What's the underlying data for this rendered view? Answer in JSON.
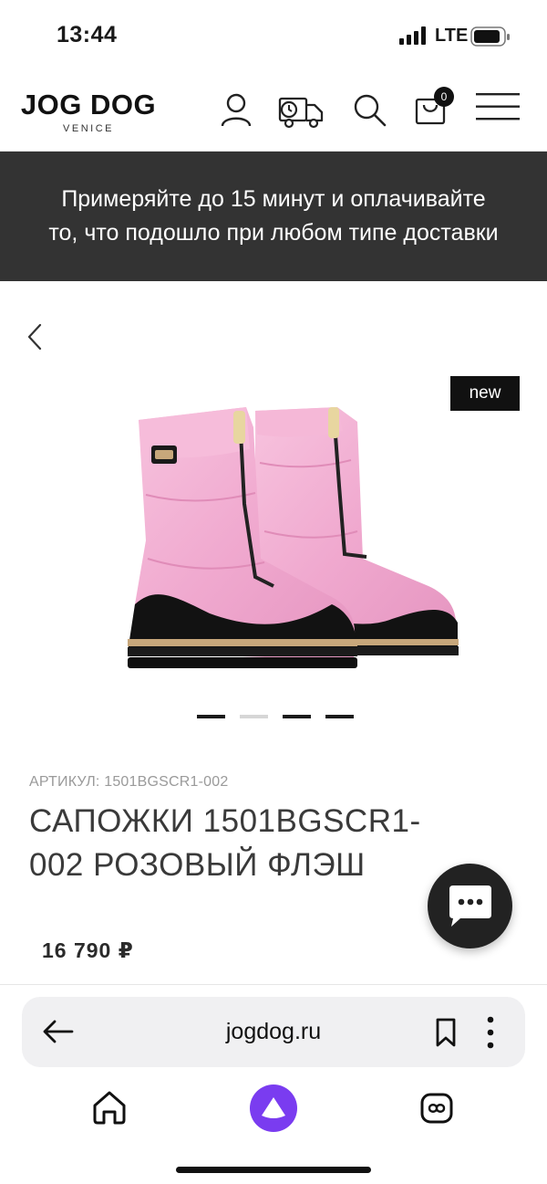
{
  "status_bar": {
    "time": "13:44",
    "network": "LTE"
  },
  "header": {
    "logo_main": "JOG DOG",
    "logo_sub": "VENICE",
    "cart_count": "0",
    "icons": [
      "user-icon",
      "delivery-truck-icon",
      "search-icon",
      "cart-icon",
      "menu-icon"
    ]
  },
  "promo": {
    "text": "Примеряйте до 15 минут и оплачивайте то, что подошло при любом типе доставки"
  },
  "product": {
    "badge": "new",
    "sku_label": "АРТИКУЛ: 1501BGSCR1-002",
    "title": "САПОЖКИ 1501BGSCR1-002 РОЗОВЫЙ ФЛЭШ",
    "price": "16 790 ₽",
    "gallery_count": 4,
    "gallery_active_index": 0,
    "colors": {
      "upper": "#f3b0d2",
      "sole": "#121212",
      "stripe": "#c7a77b"
    }
  },
  "browser": {
    "url": "jogdog.ru"
  },
  "colors": {
    "banner_bg": "#333333",
    "alice_purple": "#7a3cf0"
  }
}
